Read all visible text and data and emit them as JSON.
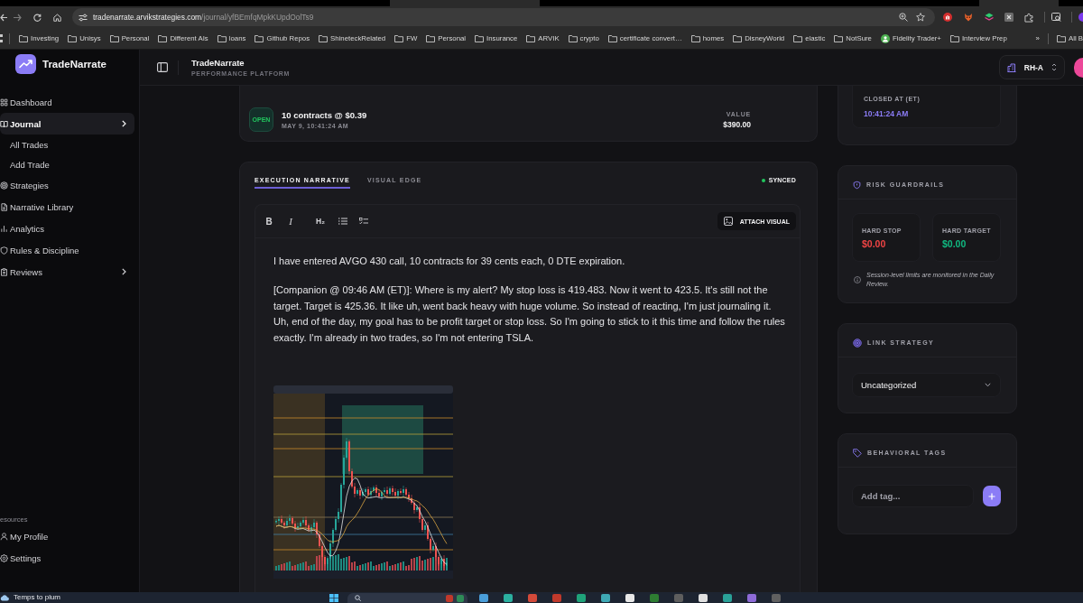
{
  "browser": {
    "address": {
      "host": "tradenarrate.arvikstrategies.com",
      "path": "/journal/yfBEmfqMpkKUpdOolTs9"
    },
    "bookmarks": [
      {
        "label": "Investing",
        "kind": "folder"
      },
      {
        "label": "Unisys",
        "kind": "folder"
      },
      {
        "label": "Personal",
        "kind": "folder"
      },
      {
        "label": "Different AIs",
        "kind": "folder"
      },
      {
        "label": "loans",
        "kind": "folder"
      },
      {
        "label": "Github Repos",
        "kind": "folder"
      },
      {
        "label": "ShineteckRelated",
        "kind": "folder"
      },
      {
        "label": "FW",
        "kind": "folder"
      },
      {
        "label": "Personal",
        "kind": "folder"
      },
      {
        "label": "Insurance",
        "kind": "folder"
      },
      {
        "label": "ARVIK",
        "kind": "folder"
      },
      {
        "label": "crypto",
        "kind": "folder"
      },
      {
        "label": "certificate convert…",
        "kind": "folder"
      },
      {
        "label": "homes",
        "kind": "folder"
      },
      {
        "label": "DisneyWorld",
        "kind": "folder"
      },
      {
        "label": "elastic",
        "kind": "folder"
      },
      {
        "label": "NotSure",
        "kind": "folder"
      },
      {
        "label": "Fidelity Trader+",
        "kind": "site"
      },
      {
        "label": "Interview Prep",
        "kind": "folder"
      }
    ],
    "overflow": "»",
    "all_bookmarks": "All B"
  },
  "sidebar": {
    "brand": "TradeNarrate",
    "items": [
      {
        "label": "Dashboard",
        "kind": "link",
        "selected": false
      },
      {
        "label": "Journal",
        "kind": "group",
        "selected": true,
        "children": [
          {
            "label": "All Trades",
            "selected": false
          },
          {
            "label": "Add Trade",
            "selected": false
          }
        ]
      },
      {
        "label": "Strategies",
        "kind": "link",
        "selected": false
      },
      {
        "label": "Narrative Library",
        "kind": "link",
        "selected": false
      },
      {
        "label": "Analytics",
        "kind": "link",
        "selected": false
      },
      {
        "label": "Rules & Discipline",
        "kind": "link",
        "selected": false
      },
      {
        "label": "Reviews",
        "kind": "group",
        "selected": false
      }
    ],
    "resources": {
      "heading": "esources",
      "items": [
        {
          "label": "My Profile",
          "selected": false
        },
        {
          "label": "Settings",
          "selected": false
        }
      ]
    }
  },
  "header": {
    "title": "TradeNarrate",
    "subtitle": "PERFORMANCE PLATFORM",
    "account": "RH-A"
  },
  "trade_entry": {
    "status": "OPEN",
    "title": "10 contracts @ $0.39",
    "time": "MAY 9, 10:41:24 AM",
    "value_label": "VALUE",
    "value": "$390.00"
  },
  "narrative": {
    "tabs": [
      {
        "label": "EXECUTION NARRATIVE",
        "selected": true
      },
      {
        "label": "VISUAL EDGE",
        "selected": false
      }
    ],
    "sync_status": "SYNCED",
    "format_buttons": [
      {
        "label": "B",
        "kind": "bold"
      },
      {
        "label": "I",
        "kind": "italic"
      },
      {
        "label": "H₂",
        "kind": "heading"
      }
    ],
    "attach_button": "ATTACH VISUAL",
    "paragraphs": [
      "I have entered AVGO 430 call, 10 contracts for 39 cents each, 0 DTE expiration.",
      "[Companion @ 09:46 AM (ET)]: Where is my alert? My stop loss is 419.483. Now it went to 423.5. It's still not the target. Target is 425.36. It like uh, went back heavy with huge volume. So instead of reacting, I'm just journaling it. Uh, end of the day, my goal has to be profit target or stop loss. So I'm going to stick to it this time and follow the rules exactly. I'm already in two trades, so I'm not entering TSLA."
    ]
  },
  "closing": {
    "label": "CLOSED AT (ET)",
    "time": "10:41:24 AM"
  },
  "risk_guardrails": {
    "title": "RISK GUARDRAILS",
    "limits": [
      {
        "label": "HARD STOP",
        "value": "$0.00",
        "color": "#ef4444"
      },
      {
        "label": "HARD TARGET",
        "value": "$0.00",
        "color": "#10b981"
      }
    ],
    "note": "Session-level limits are monitored in the Daily Review."
  },
  "link_strategy": {
    "title": "LINK STRATEGY",
    "value": "Uncategorized"
  },
  "behavioral_tags": {
    "title": "BEHAVIORAL TAGS",
    "placeholder": "Add tag..."
  },
  "taskbar": {
    "weather": "Temps to plum"
  }
}
